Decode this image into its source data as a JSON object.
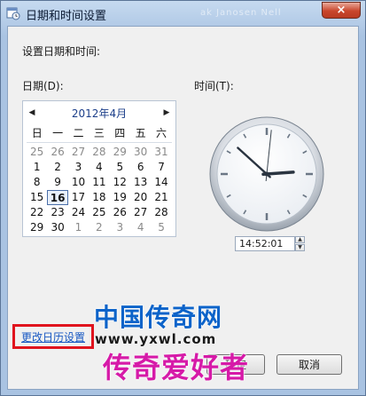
{
  "window": {
    "title": "日期和时间设置",
    "title_ghost": "ak Janosen Nell",
    "close_glyph": "×"
  },
  "main": {
    "heading": "设置日期和时间:",
    "date_label": "日期(D):",
    "time_label": "时间(T):"
  },
  "calendar": {
    "prev_glyph": "◀",
    "next_glyph": "▶",
    "month_title": "2012年4月",
    "weekdays": [
      "日",
      "一",
      "二",
      "三",
      "四",
      "五",
      "六"
    ],
    "weeks": [
      [
        {
          "d": "25",
          "other": true
        },
        {
          "d": "26",
          "other": true
        },
        {
          "d": "27",
          "other": true
        },
        {
          "d": "28",
          "other": true
        },
        {
          "d": "29",
          "other": true
        },
        {
          "d": "30",
          "other": true
        },
        {
          "d": "31",
          "other": true
        }
      ],
      [
        {
          "d": "1"
        },
        {
          "d": "2"
        },
        {
          "d": "3"
        },
        {
          "d": "4"
        },
        {
          "d": "5"
        },
        {
          "d": "6"
        },
        {
          "d": "7"
        }
      ],
      [
        {
          "d": "8"
        },
        {
          "d": "9"
        },
        {
          "d": "10"
        },
        {
          "d": "11"
        },
        {
          "d": "12"
        },
        {
          "d": "13"
        },
        {
          "d": "14"
        }
      ],
      [
        {
          "d": "15"
        },
        {
          "d": "16",
          "today": true
        },
        {
          "d": "17"
        },
        {
          "d": "18"
        },
        {
          "d": "19"
        },
        {
          "d": "20"
        },
        {
          "d": "21"
        }
      ],
      [
        {
          "d": "22"
        },
        {
          "d": "23"
        },
        {
          "d": "24"
        },
        {
          "d": "25"
        },
        {
          "d": "26"
        },
        {
          "d": "27"
        },
        {
          "d": "28"
        }
      ],
      [
        {
          "d": "29"
        },
        {
          "d": "30"
        },
        {
          "d": "1",
          "other": true
        },
        {
          "d": "2",
          "other": true
        },
        {
          "d": "3",
          "other": true
        },
        {
          "d": "4",
          "other": true
        },
        {
          "d": "5",
          "other": true
        }
      ]
    ]
  },
  "clock": {
    "hour": 2,
    "minute": 52,
    "second": 1
  },
  "time": {
    "value": "14:52:01"
  },
  "footer": {
    "change_calendar_link": "更改日历设置",
    "ok_label": "确定",
    "cancel_label": "取消"
  },
  "watermark": {
    "top": "中国传奇网",
    "url": "www.yxwl.com",
    "bottom": "传奇爱好者"
  },
  "colors": {
    "accent": "#1757c2",
    "highlight_border": "#e0141e",
    "watermark_blue": "#0c63c9",
    "watermark_pink": "#d61aa8"
  }
}
